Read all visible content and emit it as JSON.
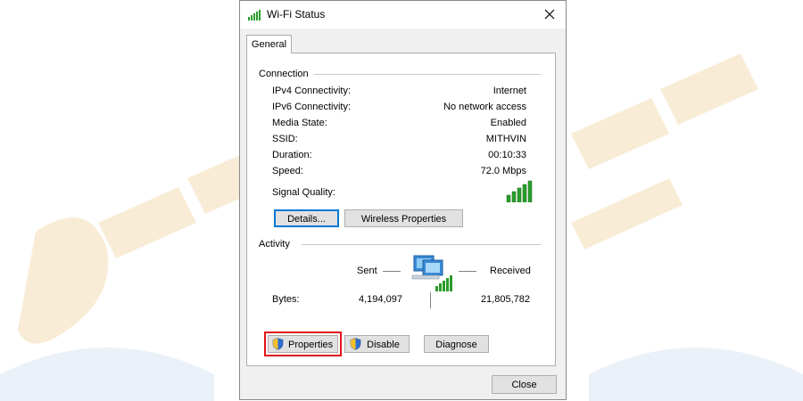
{
  "window": {
    "title": "Wi-Fi Status"
  },
  "tabs": [
    {
      "label": "General"
    }
  ],
  "connection": {
    "heading": "Connection",
    "rows": [
      {
        "label": "IPv4 Connectivity:",
        "value": "Internet"
      },
      {
        "label": "IPv6 Connectivity:",
        "value": "No network access"
      },
      {
        "label": "Media State:",
        "value": "Enabled"
      },
      {
        "label": "SSID:",
        "value": "MITHVIN"
      },
      {
        "label": "Duration:",
        "value": "00:10:33"
      },
      {
        "label": "Speed:",
        "value": "72.0 Mbps"
      }
    ],
    "signal_label": "Signal Quality:",
    "signal_bars_lit": 5,
    "signal_bars_total": 5,
    "details_button": "Details...",
    "wireless_properties_button": "Wireless Properties"
  },
  "activity": {
    "heading": "Activity",
    "sent_label": "Sent",
    "received_label": "Received",
    "bytes_label": "Bytes:",
    "bytes_sent": "4,194,097",
    "bytes_received": "21,805,782"
  },
  "actions": {
    "properties_button": "Properties",
    "disable_button": "Disable",
    "diagnose_button": "Diagnose",
    "close_button": "Close"
  },
  "icons": {
    "title": "wifi-signal-icon",
    "close": "close-icon",
    "signal": "signal-strength-icon",
    "network": "network-computers-icon",
    "shield": "uac-shield-icon"
  },
  "colors": {
    "signal_green": "#2a9d2a",
    "highlight_red": "#e0121a",
    "focus_blue": "#0078d7",
    "watermark": "#f6e7c9"
  }
}
